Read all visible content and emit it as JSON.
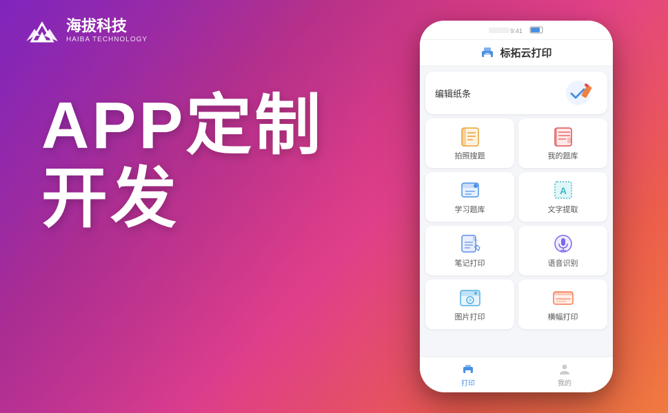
{
  "brand": {
    "logo_cn": "海拔科技",
    "logo_en": "HAIBA TECHNOLOGY"
  },
  "headline": {
    "line1": "APP定制",
    "line2": "开发"
  },
  "phone": {
    "header_title": "标拓云打印",
    "banner_text": "编辑纸条",
    "menu_items": [
      {
        "label": "拍照搜题",
        "icon": "book"
      },
      {
        "label": "我的题库",
        "icon": "notebook"
      },
      {
        "label": "学习题库",
        "icon": "study"
      },
      {
        "label": "文字提取",
        "icon": "text"
      },
      {
        "label": "笔记打印",
        "icon": "note"
      },
      {
        "label": "语音识别",
        "icon": "voice"
      },
      {
        "label": "图片打印",
        "icon": "photo"
      },
      {
        "label": "横幅打印",
        "icon": "landscape"
      }
    ],
    "nav": [
      {
        "label": "打印",
        "active": true
      },
      {
        "label": "我的",
        "active": false
      }
    ]
  }
}
